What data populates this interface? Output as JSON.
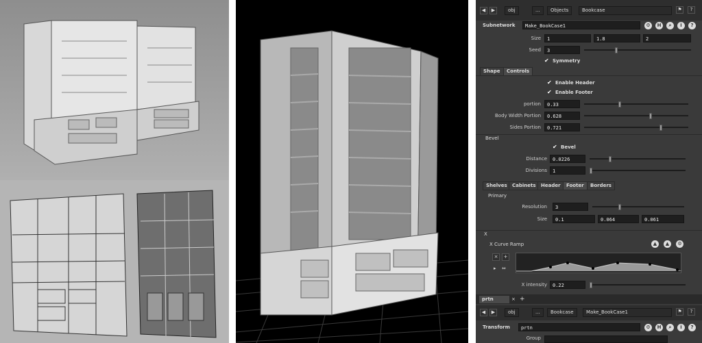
{
  "header": {
    "crumbs": [
      "obj",
      "...",
      "Objects",
      "Bookcase"
    ]
  },
  "node": {
    "type": "Subnetwork",
    "name": "Make_BookCase1"
  },
  "params": {
    "size_label": "Size",
    "size": [
      "1",
      "1.8",
      "2"
    ],
    "seed_label": "Seed",
    "seed": "3",
    "symmetry": "Symmetry"
  },
  "tabs1": [
    "Shape",
    "Controls"
  ],
  "controls": {
    "enable_header": "Enable Header",
    "enable_footer": "Enable Footer",
    "portion_label": "portion",
    "portion": "0.33",
    "bwp_label": "Body Width Portion",
    "bwp": "0.628",
    "sp_label": "Sides Portion",
    "sp": "0.721"
  },
  "bevel": {
    "folder": "Bevel",
    "toggle": "Bevel",
    "dist_label": "Distance",
    "dist": "0.0226",
    "div_label": "Divisions",
    "div": "1"
  },
  "tabs2": [
    "Shelves",
    "Cabinets",
    "Header",
    "Footer",
    "Borders"
  ],
  "primary": {
    "folder": "Primary",
    "res_label": "Resolution",
    "res": "3",
    "size_label": "Size",
    "size": [
      "0.1",
      "0.064",
      "0.061"
    ]
  },
  "xsec": {
    "folder": "X",
    "ramp_label": "X Curve Ramp",
    "int_label": "X intensity",
    "int": "0.22"
  },
  "pane2": {
    "tab": "prtn",
    "plus": "+",
    "crumbs": [
      "obj",
      "...",
      "Bookcase",
      "Make_BookCase1"
    ]
  },
  "node2": {
    "type": "Transform",
    "name": "prtn",
    "group_label": "Group"
  },
  "colors": {
    "panel": "#3a3a3a",
    "field": "#1e1e1e",
    "viewport_bg": "#000000"
  }
}
